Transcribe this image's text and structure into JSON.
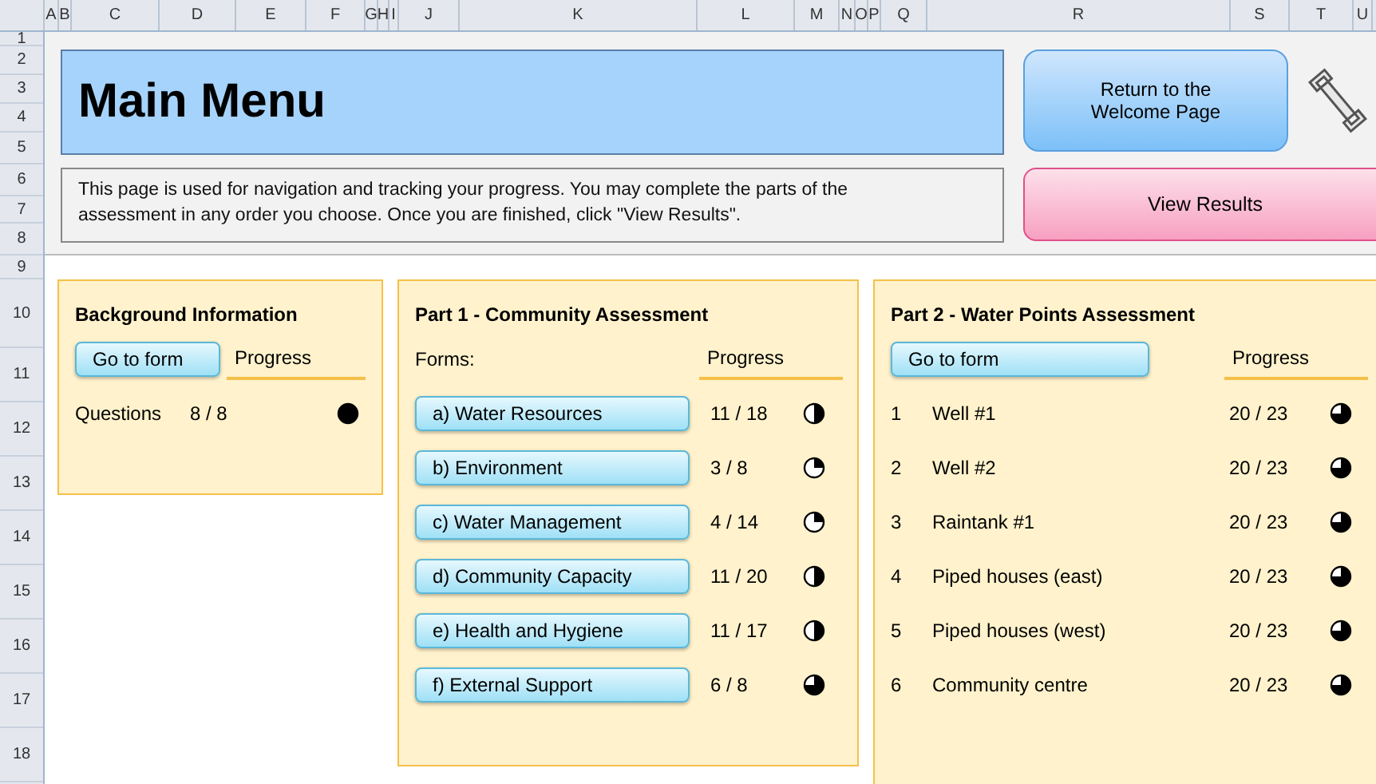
{
  "sheet": {
    "columns": [
      "A",
      "B",
      "C",
      "D",
      "E",
      "F",
      "G",
      "H",
      "I",
      "J",
      "K",
      "L",
      "M",
      "N",
      "O",
      "P",
      "Q",
      "R",
      "S",
      "T",
      "U"
    ],
    "rows": [
      "1",
      "2",
      "3",
      "4",
      "5",
      "6",
      "7",
      "8",
      "9",
      "10",
      "11",
      "12",
      "13",
      "14",
      "15",
      "16",
      "17",
      "18"
    ]
  },
  "header": {
    "title": "Main Menu",
    "description": "This page is used for navigation and tracking your progress.  You may complete  the parts of the assessment in any order you choose. Once you are finished, click \"View Results\".",
    "return_button": "Return to the Welcome Page",
    "results_button": "View Results"
  },
  "background": {
    "title": "Background Information",
    "button": "Go to form",
    "progress_label": "Progress",
    "rows": [
      {
        "label": "Questions",
        "count": "8 / 8",
        "kind": "full"
      }
    ]
  },
  "part1": {
    "title": "Part 1 - Community Assessment",
    "forms_label": "Forms:",
    "progress_label": "Progress",
    "forms": [
      {
        "label": "a) Water Resources",
        "count": "11 / 18",
        "kind": "half"
      },
      {
        "label": "b) Environment",
        "count": "3 / 8",
        "kind": "quarter"
      },
      {
        "label": "c) Water Management",
        "count": "4 / 14",
        "kind": "quarter"
      },
      {
        "label": "d) Community Capacity",
        "count": "11 / 20",
        "kind": "half"
      },
      {
        "label": "e) Health and Hygiene",
        "count": "11 / 17",
        "kind": "half"
      },
      {
        "label": "f) External Support",
        "count": "6 / 8",
        "kind": "three_quarter"
      }
    ]
  },
  "part2": {
    "title": "Part 2 - Water Points Assessment",
    "button": "Go to form",
    "progress_label": "Progress",
    "points": [
      {
        "number": "1",
        "name": "Well #1",
        "count": "20 / 23",
        "kind": "three_quarter"
      },
      {
        "number": "2",
        "name": "Well #2",
        "count": "20 / 23",
        "kind": "three_quarter"
      },
      {
        "number": "3",
        "name": "Raintank #1",
        "count": "20 / 23",
        "kind": "three_quarter"
      },
      {
        "number": "4",
        "name": "Piped houses (east)",
        "count": "20 / 23",
        "kind": "three_quarter"
      },
      {
        "number": "5",
        "name": "Piped houses (west)",
        "count": "20 / 23",
        "kind": "three_quarter"
      },
      {
        "number": "6",
        "name": "Community centre",
        "count": "20 / 23",
        "kind": "three_quarter"
      }
    ]
  }
}
